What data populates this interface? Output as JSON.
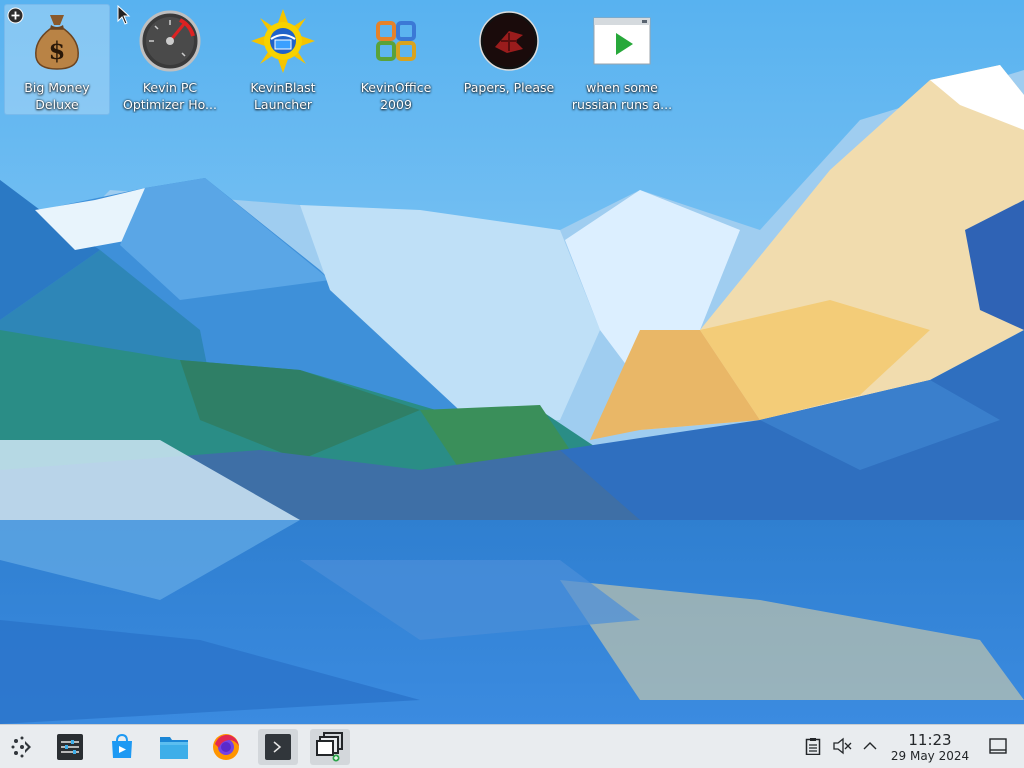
{
  "desktop": {
    "icons": [
      {
        "label": "Big Money\nDeluxe",
        "icon": "money-bag-icon"
      },
      {
        "label": "Kevin PC\nOptimizer Ho...",
        "icon": "speedometer-icon"
      },
      {
        "label": "KevinBlast\nLauncher",
        "icon": "sun-globe-icon"
      },
      {
        "label": "KevinOffice\n2009",
        "icon": "office-logo-icon"
      },
      {
        "label": "Papers, Please",
        "icon": "papers-please-emblem-icon"
      },
      {
        "label": "when some\nrussian runs a...",
        "icon": "video-play-icon"
      }
    ],
    "add_badge": "plus-icon",
    "cursor": "mouse-pointer-icon"
  },
  "taskbar": {
    "launchers": [
      {
        "name": "application-launcher",
        "icon": "kde-launcher-icon"
      },
      {
        "name": "system-settings",
        "icon": "settings-sliders-icon"
      },
      {
        "name": "discover",
        "icon": "discover-store-icon"
      },
      {
        "name": "file-manager",
        "icon": "folder-icon"
      },
      {
        "name": "firefox",
        "icon": "firefox-icon"
      },
      {
        "name": "terminal",
        "icon": "terminal-icon"
      },
      {
        "name": "window-switcher",
        "icon": "window-stack-icon"
      }
    ],
    "tray": {
      "icons": [
        "clipboard-icon",
        "volume-muted-icon",
        "chevron-up-icon"
      ]
    },
    "clock": {
      "time": "11:23",
      "date": "29 May 2024"
    },
    "show_desktop": "show-desktop-icon"
  },
  "colors": {
    "taskbar_bg": "#e9ecef",
    "sky": "#6fb8ee",
    "selection": "#aad7f5"
  }
}
